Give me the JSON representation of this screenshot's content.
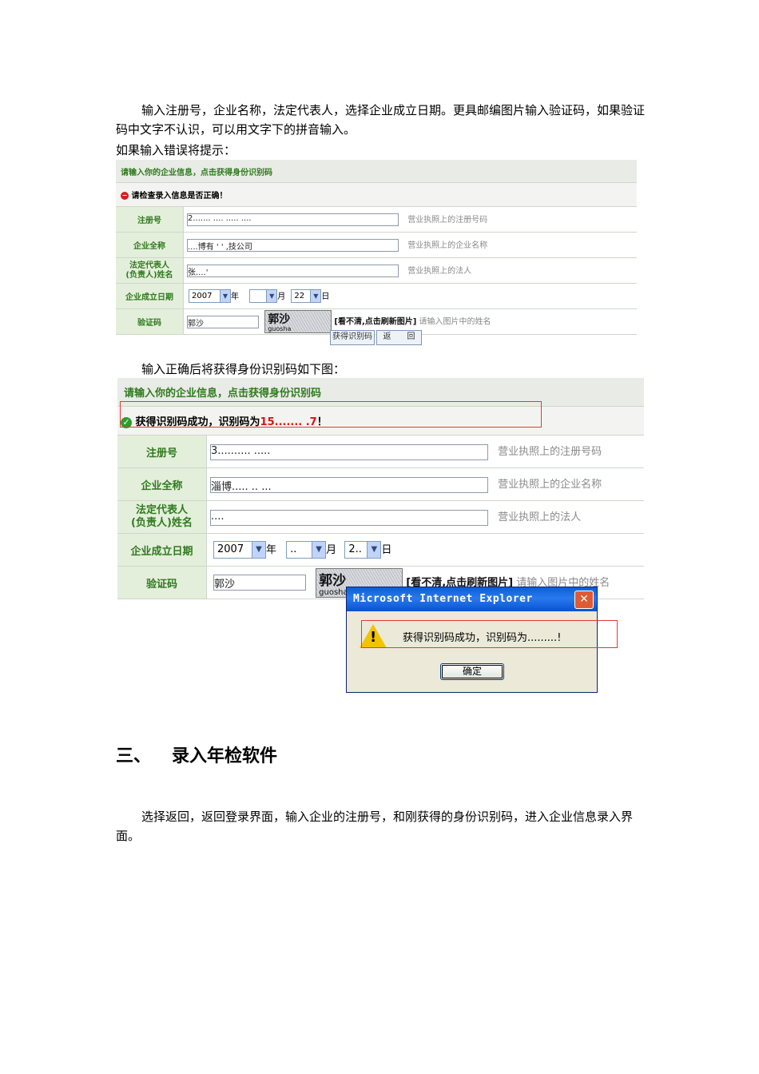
{
  "intro": {
    "line1": "输入注册号，企业名称，法定代表人，选择企业成立日期。更具邮编图片输入验证码，如果验证码中文字不认识，可以用文字下的拼音输入。",
    "line2": "如果输入错误将提示："
  },
  "form1": {
    "header": "请输入你的企业信息，点击获得身份识别码",
    "message": "请检查录入信息是否正确！",
    "rows": {
      "reg_label": "注册号",
      "reg_value": "2....... .... ..... ....",
      "reg_hint": "营业执照上的注册号码",
      "name_label": "企业全称",
      "name_value": "....博有 ' '  ,技公司",
      "name_hint": "营业执照上的企业名称",
      "rep_label_1": "法定代表人",
      "rep_label_2": "(负责人)姓名",
      "rep_value": "张....'",
      "rep_hint": "营业执照上的法人",
      "date_label": "企业成立日期",
      "year": "2007",
      "year_unit": "年",
      "month": "",
      "month_unit": "月",
      "day": "22",
      "day_unit": "日",
      "code_label": "验证码",
      "code_value": "郭沙",
      "captcha_big": "郭沙",
      "captcha_small": "guosha",
      "refresh_link": "[看不清,点击刷新图片]",
      "code_hint": "请输入图片中的姓名"
    },
    "btn_get": "获得识别码",
    "btn_back": "返　　回"
  },
  "middle_text": "输入正确后将获得身份识别码如下图：",
  "form2": {
    "header": "请输入你的企业信息，点击获得身份识别码",
    "message_prefix": "获得识别码成功，识别码为",
    "message_code": "15....... .7",
    "message_suffix": "！",
    "rows": {
      "reg_label": "注册号",
      "reg_value": "3.......... .....",
      "reg_hint": "营业执照上的注册号码",
      "name_label": "企业全称",
      "name_value": "淄博..... .. ...",
      "name_hint": "营业执照上的企业名称",
      "rep_label_1": "法定代表人",
      "rep_label_2": "(负责人)姓名",
      "rep_value": "....",
      "rep_hint": "营业执照上的法人",
      "date_label": "企业成立日期",
      "year": "2007",
      "year_unit": "年",
      "month": "..",
      "month_unit": "月",
      "day": "2..",
      "day_unit": "日",
      "code_label": "验证码",
      "code_value": "郭沙",
      "captcha_big": "郭沙",
      "captcha_small": "guosha",
      "refresh_link": "[看不清,点击刷新图片]",
      "code_hint": "请输入图片中的姓名"
    }
  },
  "dialog": {
    "title": "Microsoft Internet Explorer",
    "close": "✕",
    "icon": "warning-icon",
    "icon_glyph": "!",
    "message": "获得识别码成功，识别码为.........!",
    "ok": "确定"
  },
  "section": {
    "number": "三、",
    "title": "录入年检软件"
  },
  "outro": "选择返回，返回登录界面，输入企业的注册号，和刚获得的身份识别码，进入企业信息录入界面。",
  "colors": {
    "green_label": "#2f7a1e",
    "highlight_red": "#e23a3a"
  }
}
